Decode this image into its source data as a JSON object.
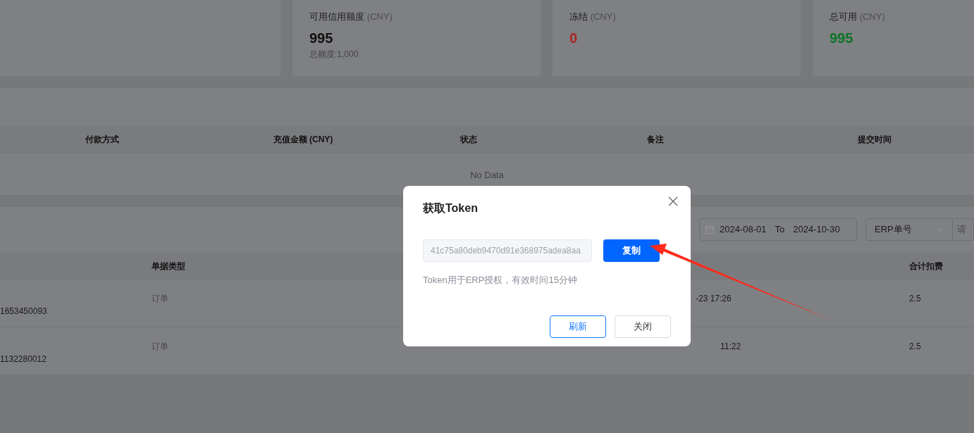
{
  "stat_cards": [
    {
      "label": "可用信用额度",
      "unit": "(CNY)",
      "value": "995",
      "color": "#111111",
      "sub": "总额度:1,000"
    },
    {
      "label": "冻结",
      "unit": "(CNY)",
      "value": "0",
      "color": "#a82424"
    },
    {
      "label": "总可用",
      "unit": "(CNY)",
      "value": "995",
      "color": "#0b7327"
    }
  ],
  "recharge_table": {
    "columns": [
      "付款方式",
      "充值金额 (CNY)",
      "状态",
      "备注",
      "提交时间"
    ],
    "empty_text": "No Data"
  },
  "filters": {
    "date_from": "2024-08-01",
    "date_sep": "To",
    "date_to": "2024-10-30",
    "select_value": "ERP单号",
    "search_placeholder": "请"
  },
  "orders_table": {
    "columns": [
      "",
      "单据类型",
      "",
      "合计扣费"
    ],
    "rows": [
      [
        "1653450093",
        "订单",
        "-23 17:26",
        "2.5"
      ],
      [
        "1132280012",
        "订单",
        "11:22",
        "2.5"
      ]
    ]
  },
  "dialog": {
    "title": "获取Token",
    "token": "41c75a80deb9470d91e368975adea8aa",
    "copy_button": "复制",
    "hint": "Token用于ERP授权，有效时间15分钟",
    "buttons": [
      {
        "label": "刷新",
        "kind": "primary-outline"
      },
      {
        "label": "关闭",
        "kind": "default"
      }
    ]
  }
}
